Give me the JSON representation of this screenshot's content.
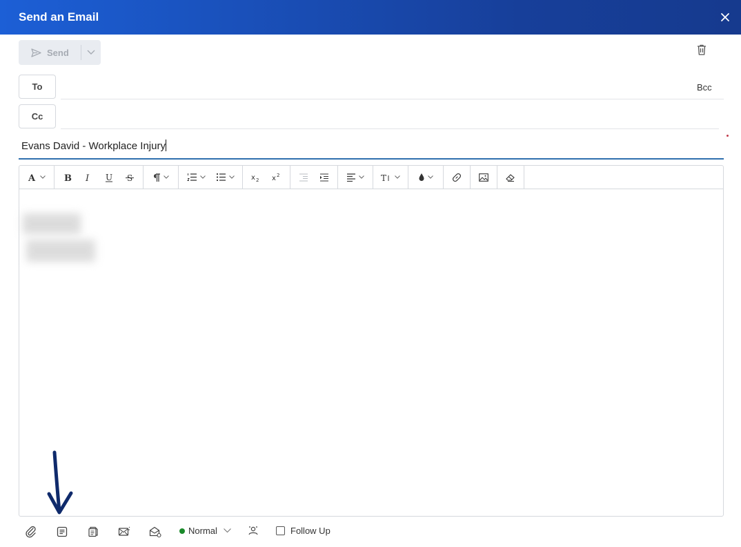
{
  "dialog": {
    "title": "Send an Email"
  },
  "actions": {
    "send_label": "Send"
  },
  "recipients": {
    "to_label": "To",
    "cc_label": "Cc",
    "bcc_label": "Bcc",
    "to_value": "",
    "cc_value": ""
  },
  "subject": {
    "value": "Evans David - Workplace Injury"
  },
  "toolbar": {
    "buttons": [
      "font-color",
      "bold",
      "italic",
      "underline",
      "strikethrough",
      "paragraph",
      "ordered-list",
      "unordered-list",
      "subscript",
      "superscript",
      "outdent",
      "indent",
      "align",
      "text-size",
      "highlight-color",
      "link",
      "image",
      "clear-formatting"
    ]
  },
  "footer": {
    "priority_label": "Normal",
    "priority_color": "#1a8a2a",
    "follow_up_label": "Follow Up",
    "follow_up_checked": false
  },
  "annotation": {
    "arrow_color": "#0f2a6b"
  }
}
